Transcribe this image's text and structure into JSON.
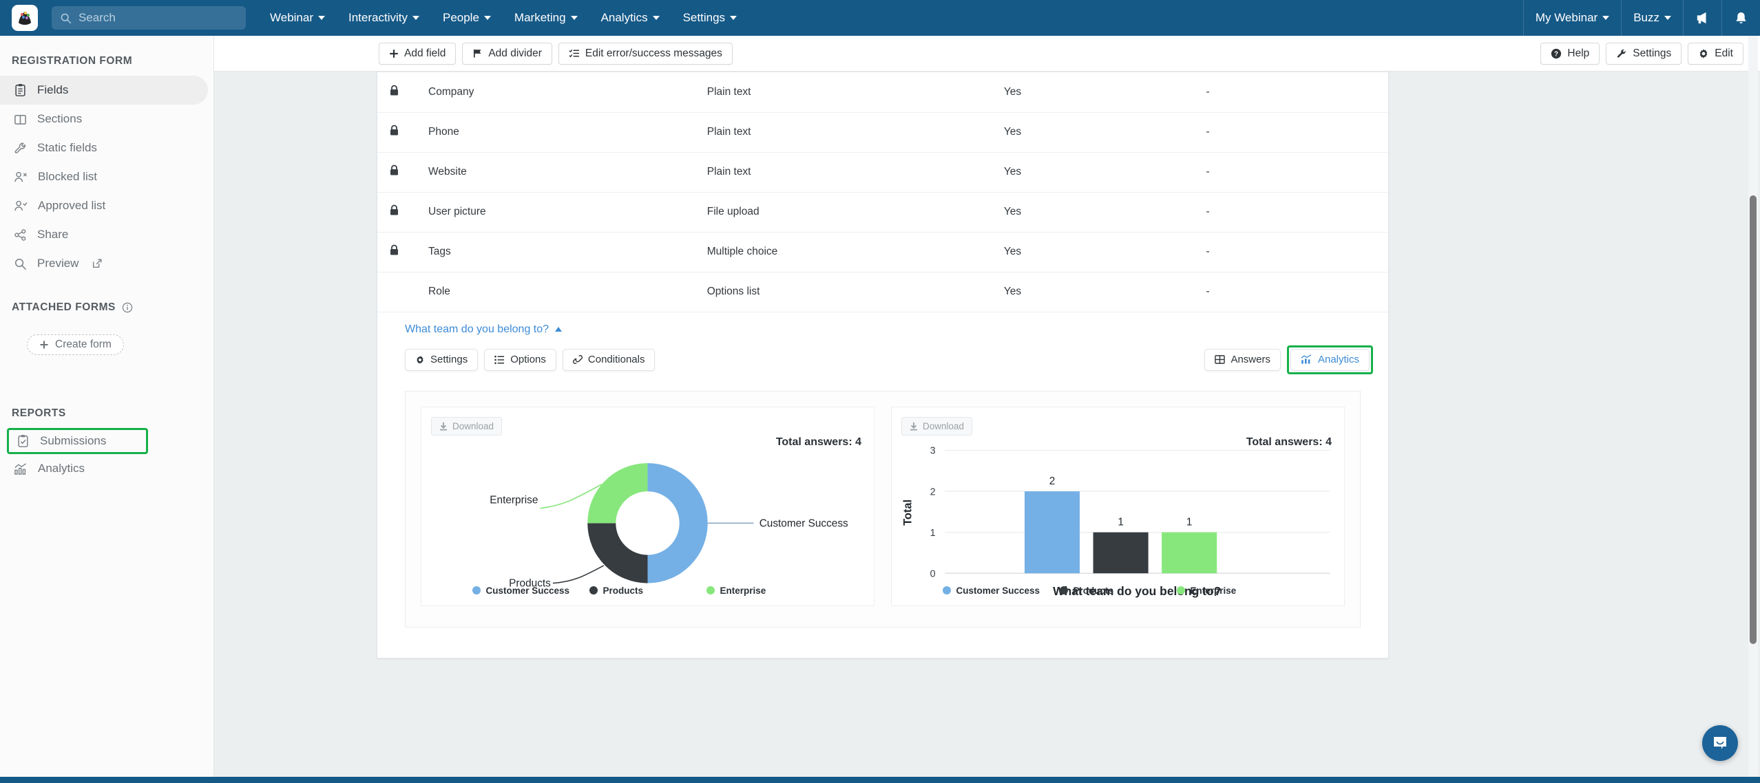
{
  "topnav": {
    "logo_icon": "app-logo-icon",
    "search": {
      "placeholder": "Search",
      "value": "",
      "icon": "search-icon"
    },
    "items": [
      {
        "label": "Webinar",
        "caret": true
      },
      {
        "label": "Interactivity",
        "caret": true
      },
      {
        "label": "People",
        "caret": true
      },
      {
        "label": "Marketing",
        "caret": true
      },
      {
        "label": "Analytics",
        "caret": true
      },
      {
        "label": "Settings",
        "caret": true
      }
    ],
    "right_items": [
      {
        "label": "My Webinar",
        "caret": true
      },
      {
        "label": "Buzz",
        "caret": true
      }
    ],
    "right_icons": [
      "megaphone-icon",
      "bell-icon"
    ]
  },
  "sidebar": {
    "section_registration": "REGISTRATION FORM",
    "items": [
      {
        "label": "Fields",
        "icon": "clipboard-icon",
        "active": true
      },
      {
        "label": "Sections",
        "icon": "columns-icon",
        "active": false
      },
      {
        "label": "Static fields",
        "icon": "wrench-icon",
        "active": false
      },
      {
        "label": "Blocked list",
        "icon": "user-x-icon",
        "active": false
      },
      {
        "label": "Approved list",
        "icon": "user-check-icon",
        "active": false
      },
      {
        "label": "Share",
        "icon": "share-icon",
        "active": false
      },
      {
        "label": "Preview",
        "icon": "magnifier-icon",
        "external": true,
        "active": false
      }
    ],
    "section_attached": "ATTACHED FORMS",
    "attached_info_icon": "info-icon",
    "create_form_label": "Create form",
    "section_reports": "REPORTS",
    "report_items": [
      {
        "label": "Submissions",
        "icon": "clipboard-check-icon",
        "highlighted": true
      },
      {
        "label": "Analytics",
        "icon": "chart-icon",
        "highlighted": false
      }
    ]
  },
  "toolbar": {
    "left_buttons": [
      {
        "label": "Add field",
        "icon": "plus-icon"
      },
      {
        "label": "Add divider",
        "icon": "flag-icon"
      },
      {
        "label": "Edit error/success messages",
        "icon": "list-check-icon"
      }
    ],
    "right_buttons": [
      {
        "label": "Help",
        "icon": "help-circle-icon"
      },
      {
        "label": "Settings",
        "icon": "wrench-icon"
      },
      {
        "label": "Edit",
        "icon": "gear-icon"
      }
    ]
  },
  "fields_table": {
    "rows": [
      {
        "locked": true,
        "name": "Company",
        "type": "Plain text",
        "required": "Yes",
        "extra": "-"
      },
      {
        "locked": true,
        "name": "Phone",
        "type": "Plain text",
        "required": "Yes",
        "extra": "-"
      },
      {
        "locked": true,
        "name": "Website",
        "type": "Plain text",
        "required": "Yes",
        "extra": "-"
      },
      {
        "locked": true,
        "name": "User picture",
        "type": "File upload",
        "required": "Yes",
        "extra": "-"
      },
      {
        "locked": true,
        "name": "Tags",
        "type": "Multiple choice",
        "required": "Yes",
        "extra": "-"
      },
      {
        "locked": false,
        "name": "Role",
        "type": "Options list",
        "required": "Yes",
        "extra": "-"
      }
    ]
  },
  "question": {
    "title": "What team do you belong to?",
    "collapse_icon": "chevron-up-icon",
    "tabs": [
      {
        "label": "Settings",
        "icon": "gear-icon"
      },
      {
        "label": "Options",
        "icon": "list-icon"
      },
      {
        "label": "Conditionals",
        "icon": "link-icon"
      }
    ],
    "view_tabs": [
      {
        "label": "Answers",
        "icon": "table-icon",
        "selected": false,
        "highlighted": false
      },
      {
        "label": "Analytics",
        "icon": "chart-icon",
        "selected": true,
        "highlighted": true
      }
    ]
  },
  "analytics": {
    "download_label": "Download",
    "download_icon": "download-icon",
    "total_answers_label": "Total answers: 4"
  },
  "colors": {
    "customer_success": "#74B0E5",
    "products": "#373C40",
    "enterprise": "#87E77C",
    "brand_blue": "#155987",
    "accent_link": "#3D8BD6",
    "highlight_green": "#15B04A"
  },
  "chart_data": [
    {
      "type": "pie",
      "variant": "donut",
      "title": "Total answers: 4",
      "labels": [
        "Customer Success",
        "Products",
        "Enterprise"
      ],
      "values": [
        2,
        1,
        1
      ],
      "percentages": [
        50,
        25,
        25
      ],
      "colors": [
        "#74B0E5",
        "#373C40",
        "#87E77C"
      ],
      "callout_labels": [
        "Customer Success",
        "Products",
        "Enterprise"
      ],
      "legend": [
        "Customer Success",
        "Products",
        "Enterprise"
      ],
      "legend_position": "bottom",
      "total": 4
    },
    {
      "type": "bar",
      "title": "Total answers: 4",
      "categories": [
        "Customer Success",
        "Products",
        "Enterprise"
      ],
      "values": [
        2,
        1,
        1
      ],
      "data_labels": [
        "2",
        "1",
        "1"
      ],
      "colors": [
        "#74B0E5",
        "#373C40",
        "#87E77C"
      ],
      "xlabel": "What team do you belong to?",
      "ylabel": "Total",
      "ylim": [
        0,
        3
      ],
      "yticks": [
        0,
        1,
        2,
        3
      ],
      "ytick_labels": [
        "0",
        "1",
        "2",
        "3"
      ],
      "grid": true,
      "legend": [
        "Customer Success",
        "Products",
        "Enterprise"
      ],
      "legend_position": "bottom",
      "total": 4
    }
  ],
  "chat": {
    "icon": "chat-bubble-icon"
  }
}
